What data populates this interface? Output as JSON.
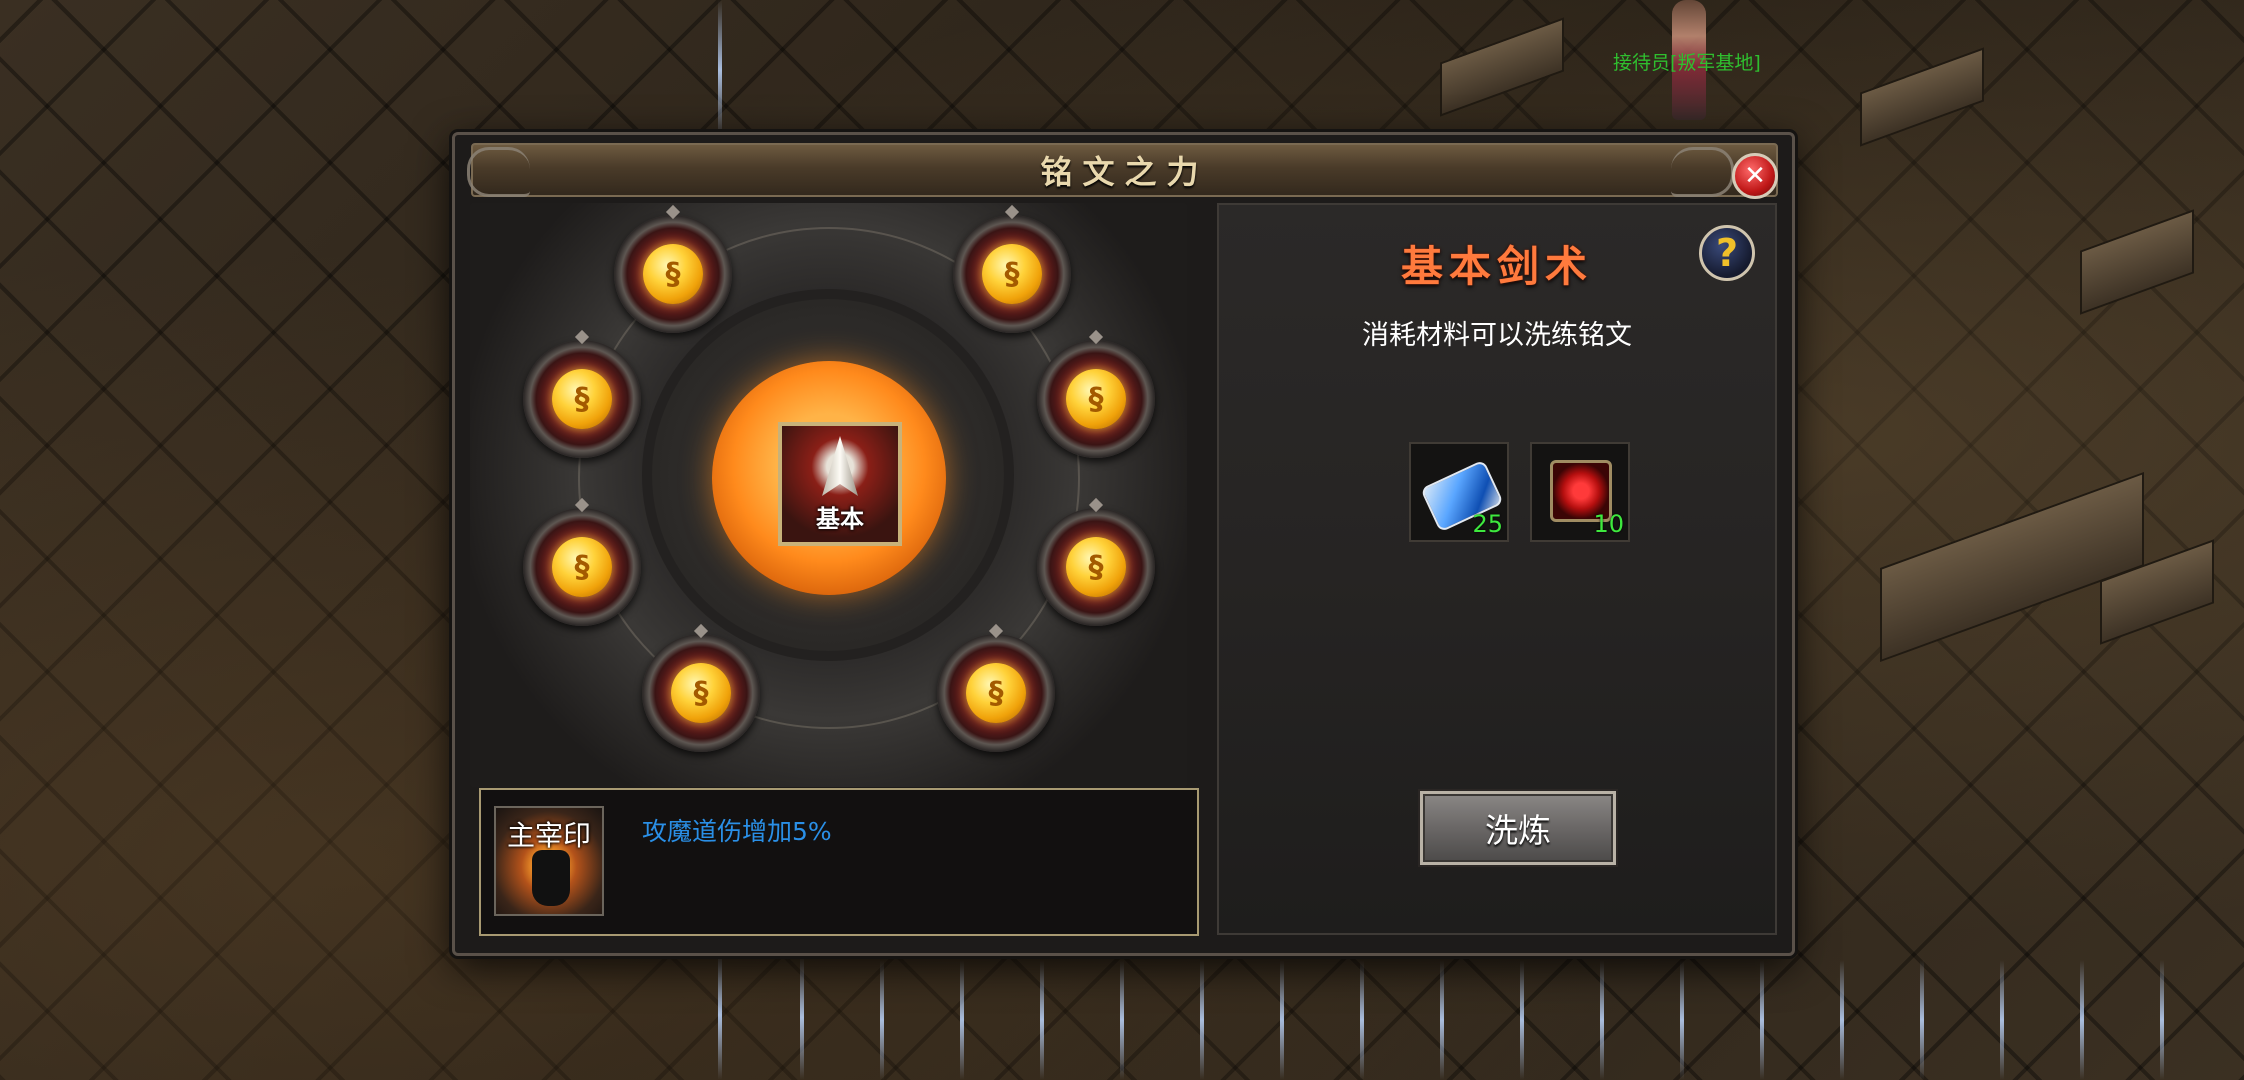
{
  "scene": {
    "npc_label": "接待员[叛军基地]"
  },
  "window": {
    "title": "铭文之力",
    "close_symbol": "✕"
  },
  "rune_wheel": {
    "center_label": "基本",
    "node_count": 8,
    "node_symbol": "§",
    "colors": {
      "core": "#ff8a1c",
      "coin": "#ffd23a"
    }
  },
  "bonus": {
    "seal_label": "主宰印",
    "effect_text": "攻魔道伤增加5%",
    "effect_color": "#2a8fe6"
  },
  "skill_panel": {
    "title": "基本剑术",
    "title_color": "#ff7a3d",
    "help_symbol": "?",
    "hint": "消耗材料可以洗练铭文",
    "materials": [
      {
        "icon": "blue-crystal-icon",
        "count": "25"
      },
      {
        "icon": "red-gem-icon",
        "count": "10"
      }
    ],
    "refine_button": "洗炼"
  }
}
